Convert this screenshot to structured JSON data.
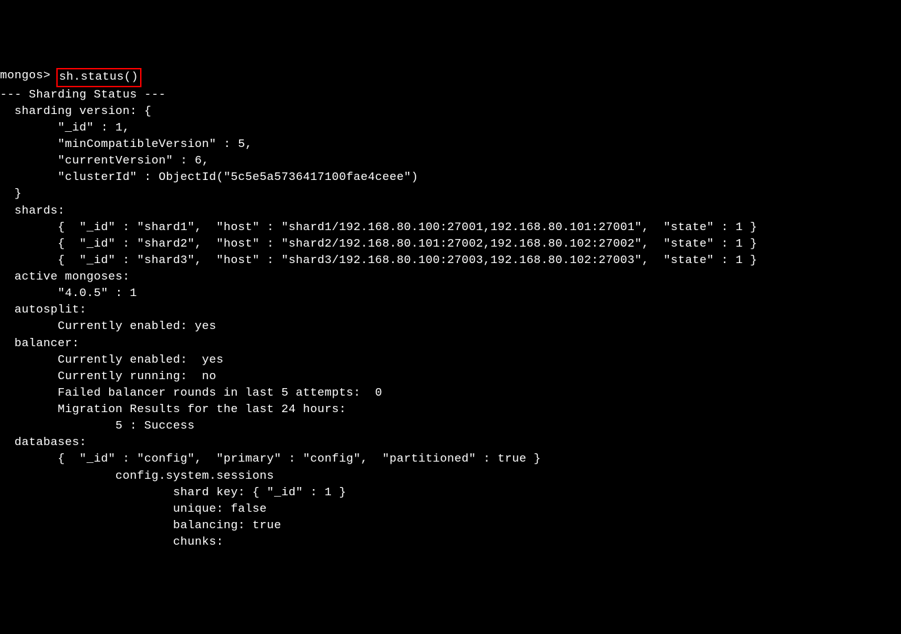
{
  "terminal": {
    "prompt": "mongos> ",
    "command": "sh.status()",
    "output": {
      "header": "--- Sharding Status --- ",
      "sharding_version_label": "  sharding version: {",
      "id_line": "        \"_id\" : 1,",
      "min_compat_line": "        \"minCompatibleVersion\" : 5,",
      "current_version_line": "        \"currentVersion\" : 6,",
      "cluster_id_line": "        \"clusterId\" : ObjectId(\"5c5e5a5736417100fae4ceee\")",
      "close_brace": "  }",
      "shards_label": "  shards:",
      "shard1": "        {  \"_id\" : \"shard1\",  \"host\" : \"shard1/192.168.80.100:27001,192.168.80.101:27001\",  \"state\" : 1 }",
      "shard2": "        {  \"_id\" : \"shard2\",  \"host\" : \"shard2/192.168.80.101:27002,192.168.80.102:27002\",  \"state\" : 1 }",
      "shard3": "        {  \"_id\" : \"shard3\",  \"host\" : \"shard3/192.168.80.100:27003,192.168.80.102:27003\",  \"state\" : 1 }",
      "active_mongoses_label": "  active mongoses:",
      "active_mongoses_value": "        \"4.0.5\" : 1",
      "autosplit_label": "  autosplit:",
      "autosplit_value": "        Currently enabled: yes",
      "balancer_label": "  balancer:",
      "balancer_enabled": "        Currently enabled:  yes",
      "balancer_running": "        Currently running:  no",
      "balancer_failed": "        Failed balancer rounds in last 5 attempts:  0",
      "migration_label": "        Migration Results for the last 24 hours: ",
      "migration_success": "                5 : Success",
      "databases_label": "  databases:",
      "db_config": "        {  \"_id\" : \"config\",  \"primary\" : \"config\",  \"partitioned\" : true }",
      "config_sessions": "                config.system.sessions",
      "shard_key": "                        shard key: { \"_id\" : 1 }",
      "unique": "                        unique: false",
      "balancing": "                        balancing: true",
      "chunks": "                        chunks:"
    }
  }
}
